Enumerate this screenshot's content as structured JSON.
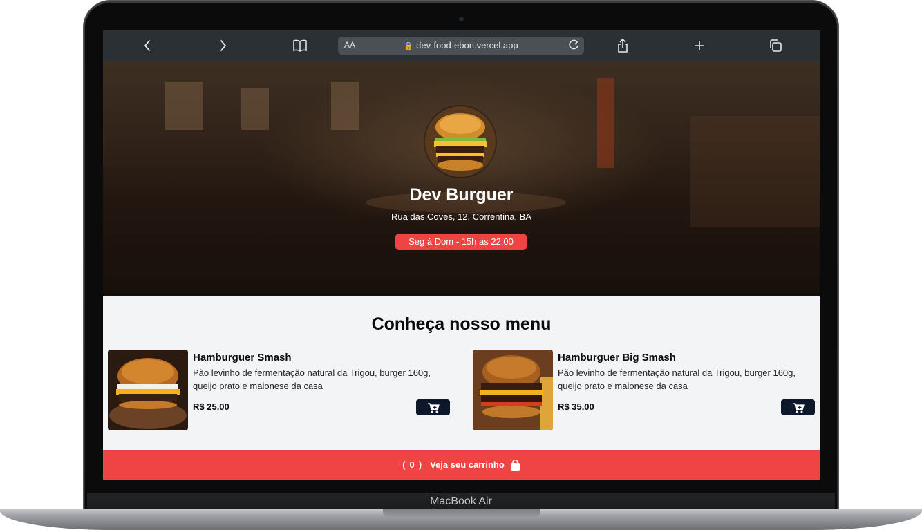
{
  "device": {
    "label": "MacBook Air"
  },
  "browser": {
    "text_size_label": "AA",
    "url": "dev-food-ebon.vercel.app",
    "icons": [
      "chevron-left-icon",
      "chevron-right-icon",
      "book-icon",
      "lock-icon",
      "reload-icon",
      "share-icon",
      "plus-icon",
      "tabs-icon"
    ]
  },
  "hero": {
    "title": "Dev Burguer",
    "address": "Rua das Coves, 12, Correntina, BA",
    "hours": "Seg á Dom - 15h as 22:00"
  },
  "menu": {
    "heading": "Conheça nosso menu",
    "items": [
      {
        "name": "Hamburguer Smash",
        "description": "Pão levinho de fermentação natural da Trigou, burger 160g, queijo prato e maionese da casa",
        "price": "R$ 25,00"
      },
      {
        "name": "Hamburguer Big Smash",
        "description": "Pão levinho de fermentação natural da Trigou, burger 160g, queijo prato e maionese da casa",
        "price": "R$ 35,00"
      }
    ]
  },
  "cart_bar": {
    "open_paren": "(",
    "count": "0",
    "close_paren": ")",
    "label": "Veja seu carrinho"
  },
  "colors": {
    "accent": "#ef4444",
    "dark": "#0f172a",
    "toolbar": "#2b3035"
  }
}
